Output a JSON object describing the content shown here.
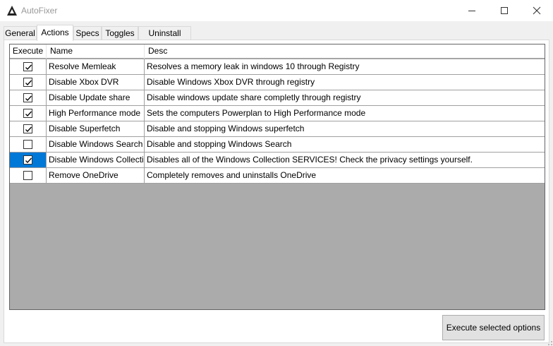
{
  "window": {
    "title": "AutoFixer"
  },
  "tabs": [
    {
      "label": "General",
      "active": false
    },
    {
      "label": "Actions",
      "active": true
    },
    {
      "label": "Specs",
      "active": false
    },
    {
      "label": "Toggles",
      "active": false
    },
    {
      "label": "Uninstall Apps",
      "active": false
    }
  ],
  "grid": {
    "columns": [
      "Execute",
      "Name",
      "Desc"
    ],
    "rows": [
      {
        "execute": true,
        "name": "Resolve Memleak",
        "desc": "Resolves a memory leak in windows 10 through Registry"
      },
      {
        "execute": true,
        "name": "Disable Xbox DVR",
        "desc": "Disable Windows Xbox DVR through registry"
      },
      {
        "execute": true,
        "name": "Disable Update share",
        "desc": "Disable windows update share completly through registry"
      },
      {
        "execute": true,
        "name": "High Performance mode",
        "desc": "Sets the computers Powerplan to High Performance mode"
      },
      {
        "execute": true,
        "name": "Disable Superfetch",
        "desc": "Disable and stopping Windows superfetch"
      },
      {
        "execute": false,
        "name": "Disable Windows Search",
        "desc": "Disable and stopping Windows Search"
      },
      {
        "execute": true,
        "name": "Disable Windows Collection",
        "desc": "Disables all of the Windows Collection SERVICES! Check the privacy settings yourself.",
        "selected": true
      },
      {
        "execute": false,
        "name": "Remove OneDrive",
        "desc": "Completely removes and uninstalls OneDrive"
      }
    ]
  },
  "buttons": {
    "execute_label": "Execute selected options"
  },
  "icons": {
    "app": "autofixer-logo-icon",
    "minimize": "minimize-icon",
    "maximize": "maximize-icon",
    "close": "close-icon",
    "check": "checkmark-icon"
  },
  "colors": {
    "selection": "#0078d7",
    "grid_background": "#ababab"
  }
}
